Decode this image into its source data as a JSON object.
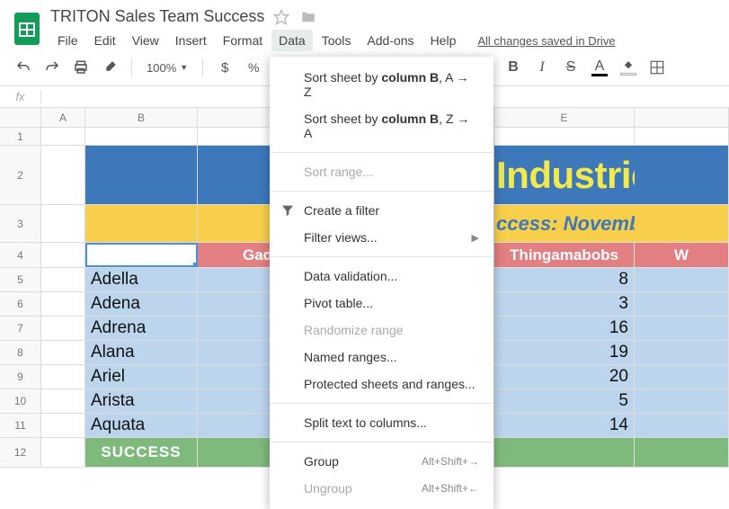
{
  "doc_title": "TRITON Sales Team Success",
  "menubar": [
    "File",
    "Edit",
    "View",
    "Insert",
    "Format",
    "Data",
    "Tools",
    "Add-ons",
    "Help"
  ],
  "active_menu_index": 5,
  "saved_text": "All changes saved in Drive",
  "zoom": "100%",
  "currency_symbol": "$",
  "percent_symbol": "%",
  "fx_label": "fx",
  "columns": [
    "A",
    "B",
    "",
    "",
    "E",
    ""
  ],
  "row_numbers": [
    "1",
    "2",
    "3",
    "4",
    "5",
    "6",
    "7",
    "8",
    "9",
    "10",
    "11",
    "12"
  ],
  "sheet": {
    "industries_text": "Industries",
    "subtitle_text": "ccess: Novembe",
    "header_gad": "Gad",
    "header_thing": "Thingamabobs",
    "header_w": "W",
    "names": [
      "Adella",
      "Adena",
      "Adrena",
      "Alana",
      "Ariel",
      "Arista",
      "Aquata"
    ],
    "values_e": [
      "8",
      "3",
      "16",
      "19",
      "20",
      "5",
      "14"
    ],
    "success_label": "SUCCESS"
  },
  "dropdown": {
    "sort_az_prefix": "Sort sheet by ",
    "sort_az_bold": "column B",
    "sort_az_suffix": ", A → Z",
    "sort_za_prefix": "Sort sheet by ",
    "sort_za_bold": "column B",
    "sort_za_suffix": ", Z → A",
    "sort_range": "Sort range...",
    "create_filter": "Create a filter",
    "filter_views": "Filter views...",
    "data_validation": "Data validation...",
    "pivot_table": "Pivot table...",
    "randomize": "Randomize range",
    "named_ranges": "Named ranges...",
    "protected": "Protected sheets and ranges...",
    "split_text": "Split text to columns...",
    "group": "Group",
    "group_shortcut": "Alt+Shift+→",
    "ungroup": "Ungroup",
    "ungroup_shortcut": "Alt+Shift+←"
  }
}
